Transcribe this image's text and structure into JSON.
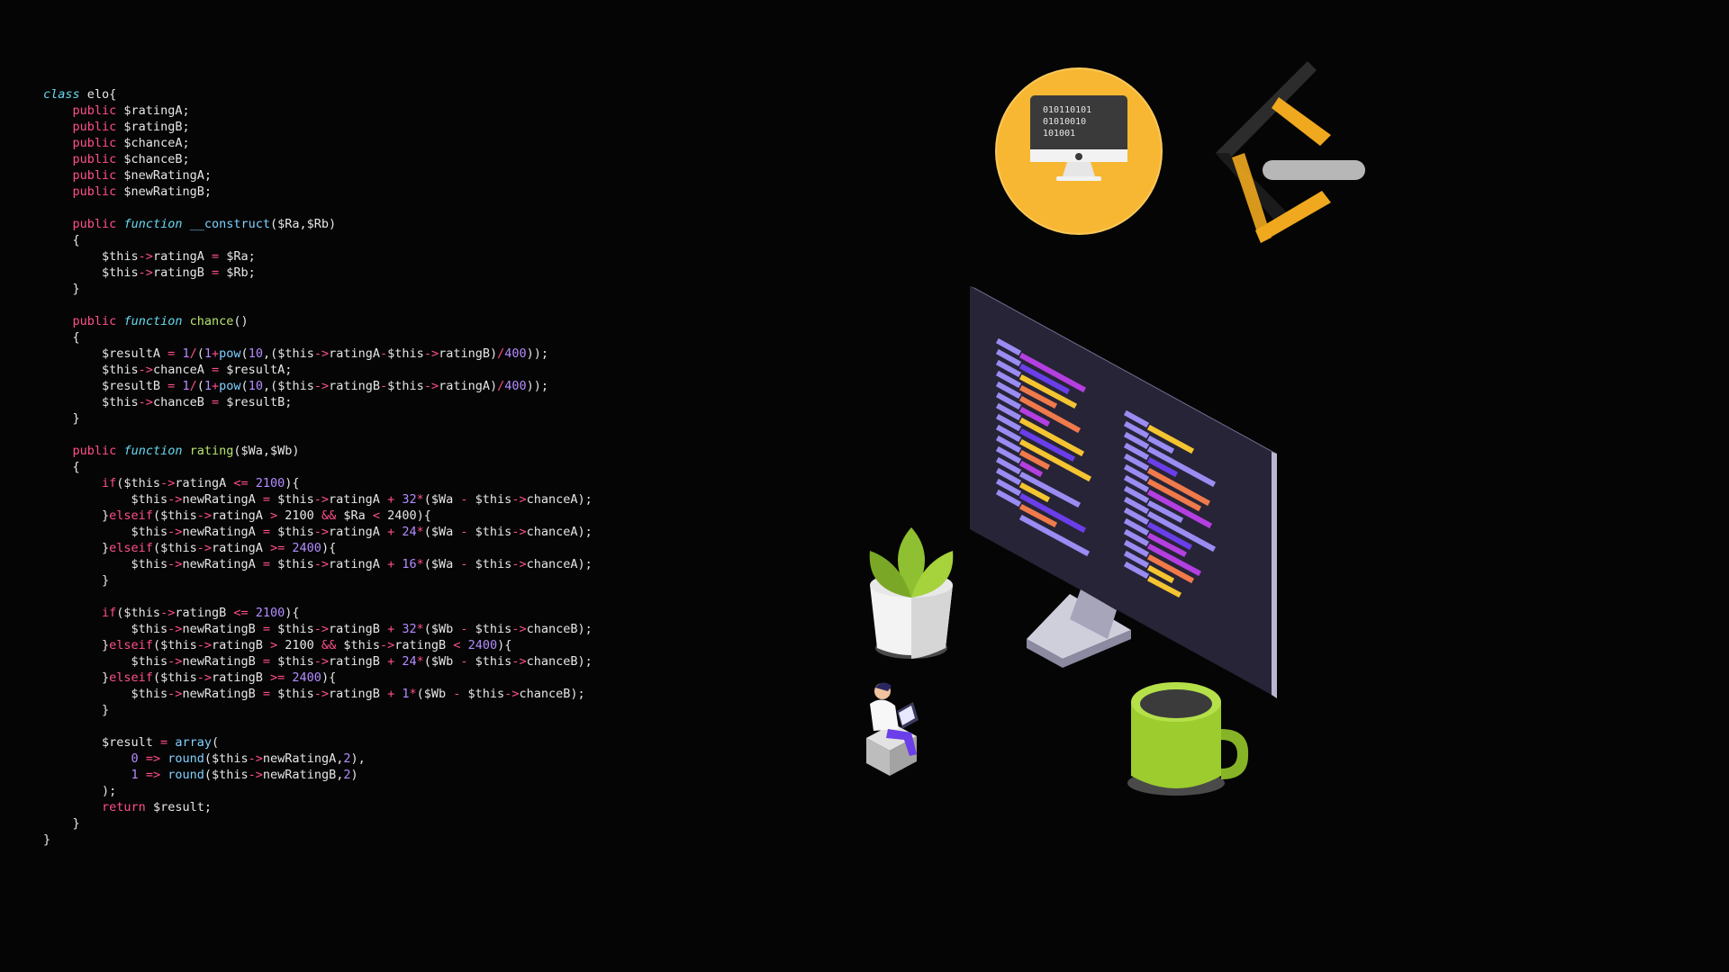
{
  "code": {
    "language": "php",
    "lines": [
      [
        [
          "kw",
          "class"
        ],
        [
          "plain",
          " elo{"
        ]
      ],
      [
        [
          "plain",
          "    "
        ],
        [
          "pub",
          "public"
        ],
        [
          "plain",
          " $ratingA;"
        ]
      ],
      [
        [
          "plain",
          "    "
        ],
        [
          "pub",
          "public"
        ],
        [
          "plain",
          " $ratingB;"
        ]
      ],
      [
        [
          "plain",
          "    "
        ],
        [
          "pub",
          "public"
        ],
        [
          "plain",
          " $chanceA;"
        ]
      ],
      [
        [
          "plain",
          "    "
        ],
        [
          "pub",
          "public"
        ],
        [
          "plain",
          " $chanceB;"
        ]
      ],
      [
        [
          "plain",
          "    "
        ],
        [
          "pub",
          "public"
        ],
        [
          "plain",
          " $newRatingA;"
        ]
      ],
      [
        [
          "plain",
          "    "
        ],
        [
          "pub",
          "public"
        ],
        [
          "plain",
          " $newRatingB;"
        ]
      ],
      [
        [
          "plain",
          ""
        ]
      ],
      [
        [
          "plain",
          "    "
        ],
        [
          "pub",
          "public"
        ],
        [
          "plain",
          " "
        ],
        [
          "kw",
          "function"
        ],
        [
          "plain",
          " "
        ],
        [
          "fn",
          "__construct"
        ],
        [
          "plain",
          "($Ra,$Rb)"
        ]
      ],
      [
        [
          "plain",
          "    {"
        ]
      ],
      [
        [
          "plain",
          "        $this"
        ],
        [
          "arrow",
          "->"
        ],
        [
          "plain",
          "ratingA "
        ],
        [
          "op",
          "="
        ],
        [
          "plain",
          " $Ra;"
        ]
      ],
      [
        [
          "plain",
          "        $this"
        ],
        [
          "arrow",
          "->"
        ],
        [
          "plain",
          "ratingB "
        ],
        [
          "op",
          "="
        ],
        [
          "plain",
          " $Rb;"
        ]
      ],
      [
        [
          "plain",
          "    }"
        ]
      ],
      [
        [
          "plain",
          ""
        ]
      ],
      [
        [
          "plain",
          "    "
        ],
        [
          "pub",
          "public"
        ],
        [
          "plain",
          " "
        ],
        [
          "kw",
          "function"
        ],
        [
          "plain",
          " "
        ],
        [
          "call",
          "chance"
        ],
        [
          "plain",
          "()"
        ]
      ],
      [
        [
          "plain",
          "    {"
        ]
      ],
      [
        [
          "plain",
          "        $resultA "
        ],
        [
          "op",
          "="
        ],
        [
          "plain",
          " "
        ],
        [
          "num",
          "1"
        ],
        [
          "op",
          "/"
        ],
        [
          "plain",
          "("
        ],
        [
          "num",
          "1"
        ],
        [
          "op",
          "+"
        ],
        [
          "fn",
          "pow"
        ],
        [
          "plain",
          "("
        ],
        [
          "num",
          "10"
        ],
        [
          "plain",
          ",($this"
        ],
        [
          "arrow",
          "->"
        ],
        [
          "plain",
          "ratingA"
        ],
        [
          "op",
          "-"
        ],
        [
          "plain",
          "$this"
        ],
        [
          "arrow",
          "->"
        ],
        [
          "plain",
          "ratingB)"
        ],
        [
          "op",
          "/"
        ],
        [
          "num",
          "400"
        ],
        [
          "plain",
          "));"
        ]
      ],
      [
        [
          "plain",
          "        $this"
        ],
        [
          "arrow",
          "->"
        ],
        [
          "plain",
          "chanceA "
        ],
        [
          "op",
          "="
        ],
        [
          "plain",
          " $resultA;"
        ]
      ],
      [
        [
          "plain",
          "        $resultB "
        ],
        [
          "op",
          "="
        ],
        [
          "plain",
          " "
        ],
        [
          "num",
          "1"
        ],
        [
          "op",
          "/"
        ],
        [
          "plain",
          "("
        ],
        [
          "num",
          "1"
        ],
        [
          "op",
          "+"
        ],
        [
          "fn",
          "pow"
        ],
        [
          "plain",
          "("
        ],
        [
          "num",
          "10"
        ],
        [
          "plain",
          ",($this"
        ],
        [
          "arrow",
          "->"
        ],
        [
          "plain",
          "ratingB"
        ],
        [
          "op",
          "-"
        ],
        [
          "plain",
          "$this"
        ],
        [
          "arrow",
          "->"
        ],
        [
          "plain",
          "ratingA)"
        ],
        [
          "op",
          "/"
        ],
        [
          "num",
          "400"
        ],
        [
          "plain",
          "));"
        ]
      ],
      [
        [
          "plain",
          "        $this"
        ],
        [
          "arrow",
          "->"
        ],
        [
          "plain",
          "chanceB "
        ],
        [
          "op",
          "="
        ],
        [
          "plain",
          " $resultB;"
        ]
      ],
      [
        [
          "plain",
          "    }"
        ]
      ],
      [
        [
          "plain",
          ""
        ]
      ],
      [
        [
          "plain",
          "    "
        ],
        [
          "pub",
          "public"
        ],
        [
          "plain",
          " "
        ],
        [
          "kw",
          "function"
        ],
        [
          "plain",
          " "
        ],
        [
          "call",
          "rating"
        ],
        [
          "plain",
          "($Wa,$Wb)"
        ]
      ],
      [
        [
          "plain",
          "    {"
        ]
      ],
      [
        [
          "plain",
          "        "
        ],
        [
          "ctrl",
          "if"
        ],
        [
          "plain",
          "($this"
        ],
        [
          "arrow",
          "->"
        ],
        [
          "plain",
          "ratingA "
        ],
        [
          "op",
          "<="
        ],
        [
          "plain",
          " "
        ],
        [
          "num",
          "2100"
        ],
        [
          "plain",
          "){"
        ]
      ],
      [
        [
          "plain",
          "            $this"
        ],
        [
          "arrow",
          "->"
        ],
        [
          "plain",
          "newRatingA "
        ],
        [
          "op",
          "="
        ],
        [
          "plain",
          " $this"
        ],
        [
          "arrow",
          "->"
        ],
        [
          "plain",
          "ratingA "
        ],
        [
          "op",
          "+"
        ],
        [
          "plain",
          " "
        ],
        [
          "num",
          "32"
        ],
        [
          "op",
          "*"
        ],
        [
          "plain",
          "($Wa "
        ],
        [
          "op",
          "-"
        ],
        [
          "plain",
          " $this"
        ],
        [
          "arrow",
          "->"
        ],
        [
          "plain",
          "chanceA);"
        ]
      ],
      [
        [
          "plain",
          "        }"
        ],
        [
          "ctrl",
          "elseif"
        ],
        [
          "plain",
          "($this"
        ],
        [
          "arrow",
          "->"
        ],
        [
          "plain",
          "ratingA "
        ],
        [
          "op",
          ">"
        ],
        [
          "plain",
          " 2100 "
        ],
        [
          "op",
          "&&"
        ],
        [
          "plain",
          " $Ra "
        ],
        [
          "op",
          "<"
        ],
        [
          "plain",
          " 2400){"
        ]
      ],
      [
        [
          "plain",
          "            $this"
        ],
        [
          "arrow",
          "->"
        ],
        [
          "plain",
          "newRatingA "
        ],
        [
          "op",
          "="
        ],
        [
          "plain",
          " $this"
        ],
        [
          "arrow",
          "->"
        ],
        [
          "plain",
          "ratingA "
        ],
        [
          "op",
          "+"
        ],
        [
          "plain",
          " "
        ],
        [
          "num",
          "24"
        ],
        [
          "op",
          "*"
        ],
        [
          "plain",
          "($Wa "
        ],
        [
          "op",
          "-"
        ],
        [
          "plain",
          " $this"
        ],
        [
          "arrow",
          "->"
        ],
        [
          "plain",
          "chanceA);"
        ]
      ],
      [
        [
          "plain",
          "        }"
        ],
        [
          "ctrl",
          "elseif"
        ],
        [
          "plain",
          "($this"
        ],
        [
          "arrow",
          "->"
        ],
        [
          "plain",
          "ratingA "
        ],
        [
          "op",
          ">="
        ],
        [
          "plain",
          " "
        ],
        [
          "num",
          "2400"
        ],
        [
          "plain",
          "){"
        ]
      ],
      [
        [
          "plain",
          "            $this"
        ],
        [
          "arrow",
          "->"
        ],
        [
          "plain",
          "newRatingA "
        ],
        [
          "op",
          "="
        ],
        [
          "plain",
          " $this"
        ],
        [
          "arrow",
          "->"
        ],
        [
          "plain",
          "ratingA "
        ],
        [
          "op",
          "+"
        ],
        [
          "plain",
          " "
        ],
        [
          "num",
          "16"
        ],
        [
          "op",
          "*"
        ],
        [
          "plain",
          "($Wa "
        ],
        [
          "op",
          "-"
        ],
        [
          "plain",
          " $this"
        ],
        [
          "arrow",
          "->"
        ],
        [
          "plain",
          "chanceA);"
        ]
      ],
      [
        [
          "plain",
          "        }"
        ]
      ],
      [
        [
          "plain",
          ""
        ]
      ],
      [
        [
          "plain",
          "        "
        ],
        [
          "ctrl",
          "if"
        ],
        [
          "plain",
          "($this"
        ],
        [
          "arrow",
          "->"
        ],
        [
          "plain",
          "ratingB "
        ],
        [
          "op",
          "<="
        ],
        [
          "plain",
          " "
        ],
        [
          "num",
          "2100"
        ],
        [
          "plain",
          "){"
        ]
      ],
      [
        [
          "plain",
          "            $this"
        ],
        [
          "arrow",
          "->"
        ],
        [
          "plain",
          "newRatingB "
        ],
        [
          "op",
          "="
        ],
        [
          "plain",
          " $this"
        ],
        [
          "arrow",
          "->"
        ],
        [
          "plain",
          "ratingB "
        ],
        [
          "op",
          "+"
        ],
        [
          "plain",
          " "
        ],
        [
          "num",
          "32"
        ],
        [
          "op",
          "*"
        ],
        [
          "plain",
          "($Wb "
        ],
        [
          "op",
          "-"
        ],
        [
          "plain",
          " $this"
        ],
        [
          "arrow",
          "->"
        ],
        [
          "plain",
          "chanceB);"
        ]
      ],
      [
        [
          "plain",
          "        }"
        ],
        [
          "ctrl",
          "elseif"
        ],
        [
          "plain",
          "($this"
        ],
        [
          "arrow",
          "->"
        ],
        [
          "plain",
          "ratingB "
        ],
        [
          "op",
          ">"
        ],
        [
          "plain",
          " 2100 "
        ],
        [
          "op",
          "&&"
        ],
        [
          "plain",
          " $this"
        ],
        [
          "arrow",
          "->"
        ],
        [
          "plain",
          "ratingB "
        ],
        [
          "op",
          "<"
        ],
        [
          "plain",
          " "
        ],
        [
          "num",
          "2400"
        ],
        [
          "plain",
          "){"
        ]
      ],
      [
        [
          "plain",
          "            $this"
        ],
        [
          "arrow",
          "->"
        ],
        [
          "plain",
          "newRatingB "
        ],
        [
          "op",
          "="
        ],
        [
          "plain",
          " $this"
        ],
        [
          "arrow",
          "->"
        ],
        [
          "plain",
          "ratingB "
        ],
        [
          "op",
          "+"
        ],
        [
          "plain",
          " "
        ],
        [
          "num",
          "24"
        ],
        [
          "op",
          "*"
        ],
        [
          "plain",
          "($Wb "
        ],
        [
          "op",
          "-"
        ],
        [
          "plain",
          " $this"
        ],
        [
          "arrow",
          "->"
        ],
        [
          "plain",
          "chanceB);"
        ]
      ],
      [
        [
          "plain",
          "        }"
        ],
        [
          "ctrl",
          "elseif"
        ],
        [
          "plain",
          "($this"
        ],
        [
          "arrow",
          "->"
        ],
        [
          "plain",
          "ratingB "
        ],
        [
          "op",
          ">="
        ],
        [
          "plain",
          " "
        ],
        [
          "num",
          "2400"
        ],
        [
          "plain",
          "){"
        ]
      ],
      [
        [
          "plain",
          "            $this"
        ],
        [
          "arrow",
          "->"
        ],
        [
          "plain",
          "newRatingB "
        ],
        [
          "op",
          "="
        ],
        [
          "plain",
          " $this"
        ],
        [
          "arrow",
          "->"
        ],
        [
          "plain",
          "ratingB "
        ],
        [
          "op",
          "+"
        ],
        [
          "plain",
          " "
        ],
        [
          "num",
          "1"
        ],
        [
          "op",
          "*"
        ],
        [
          "plain",
          "($Wb "
        ],
        [
          "op",
          "-"
        ],
        [
          "plain",
          " $this"
        ],
        [
          "arrow",
          "->"
        ],
        [
          "plain",
          "chanceB);"
        ]
      ],
      [
        [
          "plain",
          "        }"
        ]
      ],
      [
        [
          "plain",
          ""
        ]
      ],
      [
        [
          "plain",
          "        $result "
        ],
        [
          "op",
          "="
        ],
        [
          "plain",
          " "
        ],
        [
          "fn",
          "array"
        ],
        [
          "plain",
          "("
        ]
      ],
      [
        [
          "plain",
          "            "
        ],
        [
          "num",
          "0"
        ],
        [
          "plain",
          " "
        ],
        [
          "op",
          "=>"
        ],
        [
          "plain",
          " "
        ],
        [
          "fn",
          "round"
        ],
        [
          "plain",
          "($this"
        ],
        [
          "arrow",
          "->"
        ],
        [
          "plain",
          "newRatingA,"
        ],
        [
          "num",
          "2"
        ],
        [
          "plain",
          "),"
        ]
      ],
      [
        [
          "plain",
          "            "
        ],
        [
          "num",
          "1"
        ],
        [
          "plain",
          " "
        ],
        [
          "op",
          "=>"
        ],
        [
          "plain",
          " "
        ],
        [
          "fn",
          "round"
        ],
        [
          "plain",
          "($this"
        ],
        [
          "arrow",
          "->"
        ],
        [
          "plain",
          "newRatingB,"
        ],
        [
          "num",
          "2"
        ],
        [
          "plain",
          ")"
        ]
      ],
      [
        [
          "plain",
          "        );"
        ]
      ],
      [
        [
          "plain",
          "        "
        ],
        [
          "ctrl",
          "return"
        ],
        [
          "plain",
          " $result;"
        ]
      ],
      [
        [
          "plain",
          "    }"
        ]
      ],
      [
        [
          "plain",
          "}"
        ]
      ]
    ]
  },
  "illustration": {
    "badge_screen_text": [
      "010110101",
      "01010010",
      "101001"
    ],
    "colors": {
      "background": "#050505",
      "badge_yellow": "#f7b733",
      "logo_dark": "#2c2c2c",
      "logo_orange": "#f0a81e",
      "logo_gray": "#b7b7b7",
      "monitor_dark": "#262436",
      "plant_green": "#8fc031",
      "mug_green": "#9ccc2e"
    },
    "icons": [
      "computer-badge-icon",
      "brand-logo-icon",
      "monitor-illustration",
      "plant-icon",
      "person-icon",
      "mug-icon"
    ]
  }
}
